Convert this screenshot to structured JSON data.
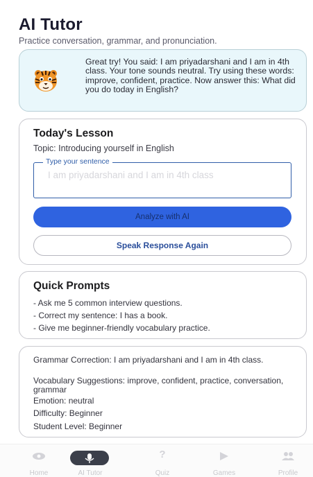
{
  "header": {
    "title": "AI Tutor",
    "subtitle": "Practice conversation, grammar, and pronunciation."
  },
  "tutor": {
    "avatar_icon": "tiger-face-icon",
    "message": "Great try! You said: I am priyadarshani and I am in 4th class. Your tone sounds neutral. Try using these words: improve, confident, practice. Now answer this: What did you do today in English?"
  },
  "lesson": {
    "title": "Today's Lesson",
    "topic": "Topic: Introducing yourself in English",
    "input_label": "Type your sentence",
    "input_value": "I am priyadarshani and I am in 4th class",
    "analyze_label": "Analyze with AI",
    "speak_label": "Speak Response Again"
  },
  "prompts": {
    "title": "Quick Prompts",
    "items": [
      "- Ask me 5 common interview questions.",
      "- Correct my sentence: I has a book.",
      "- Give me beginner-friendly vocabulary practice."
    ]
  },
  "analysis": {
    "grammar": "Grammar Correction: I am priyadarshani and I am in 4th class.",
    "vocabulary": "Vocabulary Suggestions: improve, confident, practice, conversation, grammar",
    "emotion": "Emotion: neutral",
    "difficulty": "Difficulty: Beginner",
    "level": "Student Level: Beginner"
  },
  "nav": {
    "items": [
      {
        "label": "Home",
        "icon": "eye-icon"
      },
      {
        "label": "AI Tutor",
        "icon": "microphone-icon",
        "active": true
      },
      {
        "label": "Quiz",
        "icon": "question-mark-icon"
      },
      {
        "label": "Games",
        "icon": "play-icon"
      },
      {
        "label": "Profile",
        "icon": "people-icon"
      }
    ]
  },
  "colors": {
    "accent": "#2f63e0",
    "tutor_bg": "#e9f7fb",
    "nav_active": "#3b3f4a"
  }
}
